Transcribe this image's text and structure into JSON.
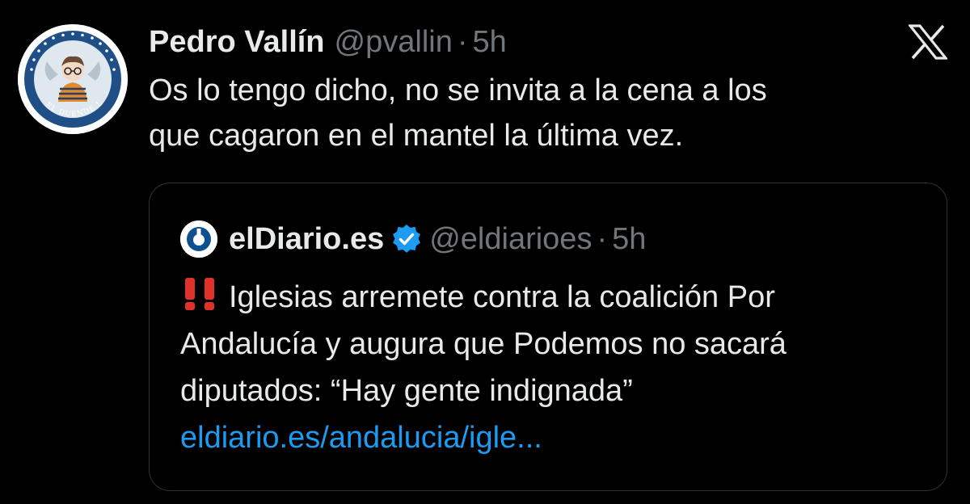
{
  "tweet": {
    "author_name": "Pedro Vallín",
    "author_handle": "@pvallin",
    "separator": "·",
    "time": "5h",
    "text_line1": "Os lo tengo dicho, no se invita a la cena a los",
    "text_line2": "que cagaron en el mantel la última vez."
  },
  "avatar_text": "EL DUENDE LA PALABRA",
  "platform_icon": "x-logo-icon",
  "quoted_tweet": {
    "author_name": "elDiario.es",
    "verified_icon": "verified-badge-icon",
    "author_handle": "@eldiarioes",
    "separator": "·",
    "time": "5h",
    "emoji": "double-exclamation-icon",
    "text_line1": "Iglesias arremete contra la coalición Por",
    "text_line2": "Andalucía y augura que Podemos no sacará",
    "text_line3": "diputados: “Hay gente indignada”",
    "link": "eldiario.es/andalucia/igle..."
  },
  "colors": {
    "background": "#000000",
    "primary_text": "#e7e9ea",
    "secondary_text": "#71767b",
    "link": "#1d9bf0",
    "border": "#2f3336",
    "verified": "#1d9bf0",
    "emoji_red": "#e0322b",
    "eldiario_blue": "#0e4f8f"
  }
}
